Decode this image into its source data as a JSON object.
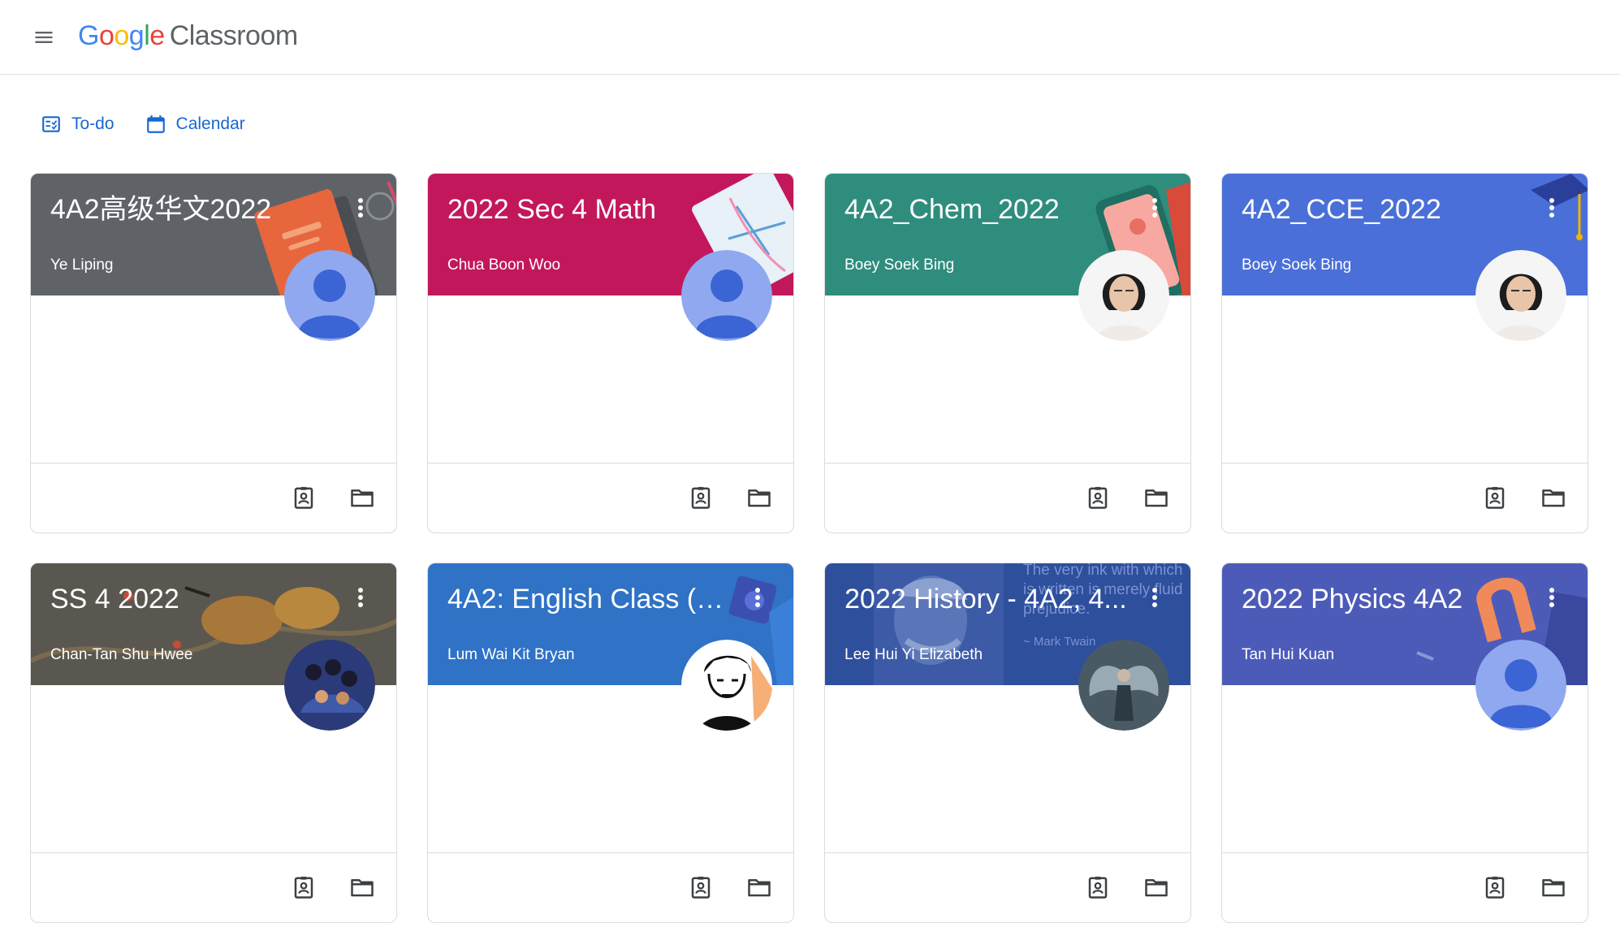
{
  "header": {
    "menu_icon": "hamburger-menu-icon",
    "logo_letters": [
      "G",
      "o",
      "o",
      "g",
      "l",
      "e"
    ],
    "product": "Classroom"
  },
  "subnav": {
    "todo_label": "To-do",
    "calendar_label": "Calendar"
  },
  "colors": {
    "accent_blue": "#1967d2",
    "banner_grey": "#5f6368",
    "banner_magenta": "#c2185b",
    "banner_teal": "#2f8d7d",
    "banner_blue": "#4a6fd8",
    "banner_english": "#2f72c6",
    "banner_history": "#2e4f9c",
    "banner_physics": "#4d5bb8"
  },
  "classes": [
    {
      "title": "4A2高级华文2022",
      "teacher": "Ye Liping",
      "banner": "grey-book",
      "avatar": "default-avatar"
    },
    {
      "title": "2022 Sec 4 Math",
      "teacher": "Chua Boon Woo",
      "banner": "magenta-math",
      "avatar": "default-avatar"
    },
    {
      "title": "4A2_Chem_2022",
      "teacher": "Boey Soek Bing",
      "banner": "teal-chem",
      "avatar": "teacher-photo"
    },
    {
      "title": "4A2_CCE_2022",
      "teacher": "Boey Soek Bing",
      "banner": "blue-grad",
      "avatar": "teacher-photo"
    },
    {
      "title": "SS 4 2022",
      "teacher": "Chan-Tan Shu Hwee",
      "banner": "birds-painting",
      "avatar": "group-photo"
    },
    {
      "title": "4A2: English Class (2...",
      "teacher": "Lum Wai Kit Bryan",
      "banner": "blue-english",
      "avatar": "sketch-portrait"
    },
    {
      "title": "2022 History - 4A2, 4...",
      "teacher": "Lee Hui Yi Elizabeth",
      "banner": "history-quote",
      "avatar": "winged-figure"
    },
    {
      "title": "2022 Physics 4A2",
      "teacher": "Tan Hui Kuan",
      "banner": "physics-magnet",
      "avatar": "default-avatar"
    }
  ],
  "history_quote": {
    "line1": "The very ink with which",
    "line2": "is written is merely fluid",
    "line3": "prejudice.",
    "author": "~ Mark Twain"
  },
  "card_actions": {
    "work_icon": "assignment-ind-icon",
    "folder_icon": "folder-icon",
    "more_icon": "more-vert-icon"
  }
}
